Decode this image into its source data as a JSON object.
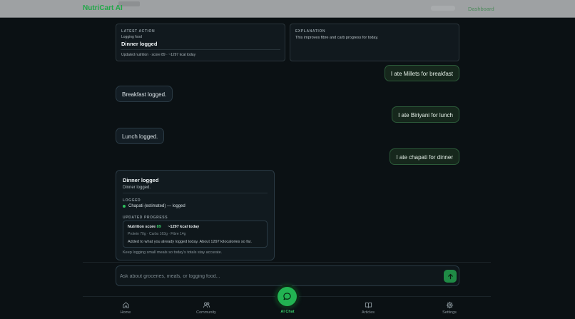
{
  "app": {
    "brand": "NutriCart AI",
    "nav_link": "Dashboard"
  },
  "latest_action": {
    "kicker": "LATEST ACTION",
    "subtitle": "Logging food",
    "title": "Dinner logged",
    "meta": "Updated nutrition · score 89 · ~1297 kcal today"
  },
  "explanation": {
    "kicker": "EXPLANATION",
    "body": "This improves fibre and carb progress for today."
  },
  "messages": [
    {
      "role": "user",
      "text": "I ate Millets for breakfast"
    },
    {
      "role": "bot",
      "text": "Breakfast logged."
    },
    {
      "role": "user",
      "text": "I ate Biriyani for lunch"
    },
    {
      "role": "bot",
      "text": "Lunch logged."
    },
    {
      "role": "user",
      "text": "I ate chapati for dinner"
    }
  ],
  "dinner_card": {
    "title": "Dinner logged",
    "subtitle": "Dinner logged.",
    "logged_label": "LOGGED",
    "logged_item": "Chapati (estimated) — logged",
    "progress_label": "UPDATED PROGRESS",
    "score_label": "Nutrition score",
    "score_value": "89",
    "kcal": "~1297 kcal today",
    "macros": "Protein 70g · Carbs 163g · Fibre 14g",
    "progress_note": "Added to what you already logged today. About 1297 kilocalories so far.",
    "footer": "Keep logging small meals so today's totals stay accurate."
  },
  "composer": {
    "placeholder": "Ask about groceries, meals, or logging food..."
  },
  "bottom_nav": {
    "home": "Home",
    "community": "Community",
    "ai_chat": "AI Chat",
    "articles": "Articles",
    "settings": "Settings"
  },
  "colors": {
    "accent": "#22b352",
    "background": "#0b1114"
  }
}
